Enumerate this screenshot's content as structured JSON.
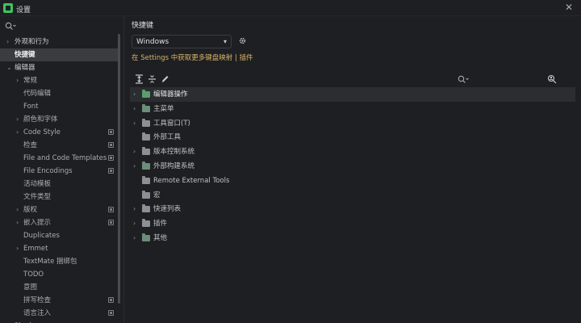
{
  "window": {
    "title": "设置"
  },
  "sidebar": {
    "items": [
      {
        "label": "外观和行为",
        "arrow": "›",
        "level": 0,
        "icon": ""
      },
      {
        "label": "快捷键",
        "arrow": "",
        "level": 0,
        "icon": "",
        "selected": true
      },
      {
        "label": "编辑器",
        "arrow": "⌄",
        "level": 0,
        "icon": ""
      },
      {
        "label": "常规",
        "arrow": "›",
        "level": 1,
        "icon": ""
      },
      {
        "label": "代码编辑",
        "arrow": "",
        "level": 1,
        "icon": ""
      },
      {
        "label": "Font",
        "arrow": "",
        "level": 1,
        "icon": ""
      },
      {
        "label": "颜色和字体",
        "arrow": "›",
        "level": 1,
        "icon": ""
      },
      {
        "label": "Code Style",
        "arrow": "›",
        "level": 1,
        "icon": "project"
      },
      {
        "label": "检查",
        "arrow": "",
        "level": 1,
        "icon": "project"
      },
      {
        "label": "File and Code Templates",
        "arrow": "",
        "level": 1,
        "icon": "project"
      },
      {
        "label": "File Encodings",
        "arrow": "",
        "level": 1,
        "icon": "project"
      },
      {
        "label": "活动模板",
        "arrow": "",
        "level": 1,
        "icon": ""
      },
      {
        "label": "文件类型",
        "arrow": "",
        "level": 1,
        "icon": ""
      },
      {
        "label": "版权",
        "arrow": "›",
        "level": 1,
        "icon": "project"
      },
      {
        "label": "嵌入提示",
        "arrow": "›",
        "level": 1,
        "icon": "project"
      },
      {
        "label": "Duplicates",
        "arrow": "",
        "level": 1,
        "icon": ""
      },
      {
        "label": "Emmet",
        "arrow": "›",
        "level": 1,
        "icon": ""
      },
      {
        "label": "TextMate 捆绑包",
        "arrow": "",
        "level": 1,
        "icon": ""
      },
      {
        "label": "TODO",
        "arrow": "",
        "level": 1,
        "icon": ""
      },
      {
        "label": "意图",
        "arrow": "",
        "level": 1,
        "icon": ""
      },
      {
        "label": "拼写检查",
        "arrow": "",
        "level": 1,
        "icon": "project"
      },
      {
        "label": "语言注入",
        "arrow": "",
        "level": 1,
        "icon": "project"
      },
      {
        "label": "Plugins",
        "arrow": "",
        "level": 0,
        "icon": "blue"
      }
    ]
  },
  "content": {
    "section_title": "快捷键",
    "keymap": {
      "value": "Windows"
    },
    "link_line": "在 Settings 中获取更多键盘映射 | 插件",
    "actions": [
      {
        "label": "编辑器操作",
        "arrow": "›",
        "folder": "green",
        "highlighted": true
      },
      {
        "label": "主菜单",
        "arrow": "›",
        "folder": "tinted"
      },
      {
        "label": "工具窗口(T)",
        "arrow": "›",
        "folder": "plain"
      },
      {
        "label": "外部工具",
        "arrow": "",
        "folder": "plain"
      },
      {
        "label": "版本控制系统",
        "arrow": "›",
        "folder": "plain"
      },
      {
        "label": "外部构建系统",
        "arrow": "›",
        "folder": "tinted"
      },
      {
        "label": "Remote External Tools",
        "arrow": "",
        "folder": "plain"
      },
      {
        "label": "宏",
        "arrow": "",
        "folder": "plain"
      },
      {
        "label": "快速列表",
        "arrow": "›",
        "folder": "plain"
      },
      {
        "label": "插件",
        "arrow": "›",
        "folder": "plain"
      },
      {
        "label": "其他",
        "arrow": "›",
        "folder": "tinted"
      }
    ]
  },
  "colors": {
    "background": "#1e1f22",
    "selected_row": "#3a3c40",
    "link": "#d7b46a",
    "app_icon": "#3ec25f"
  }
}
